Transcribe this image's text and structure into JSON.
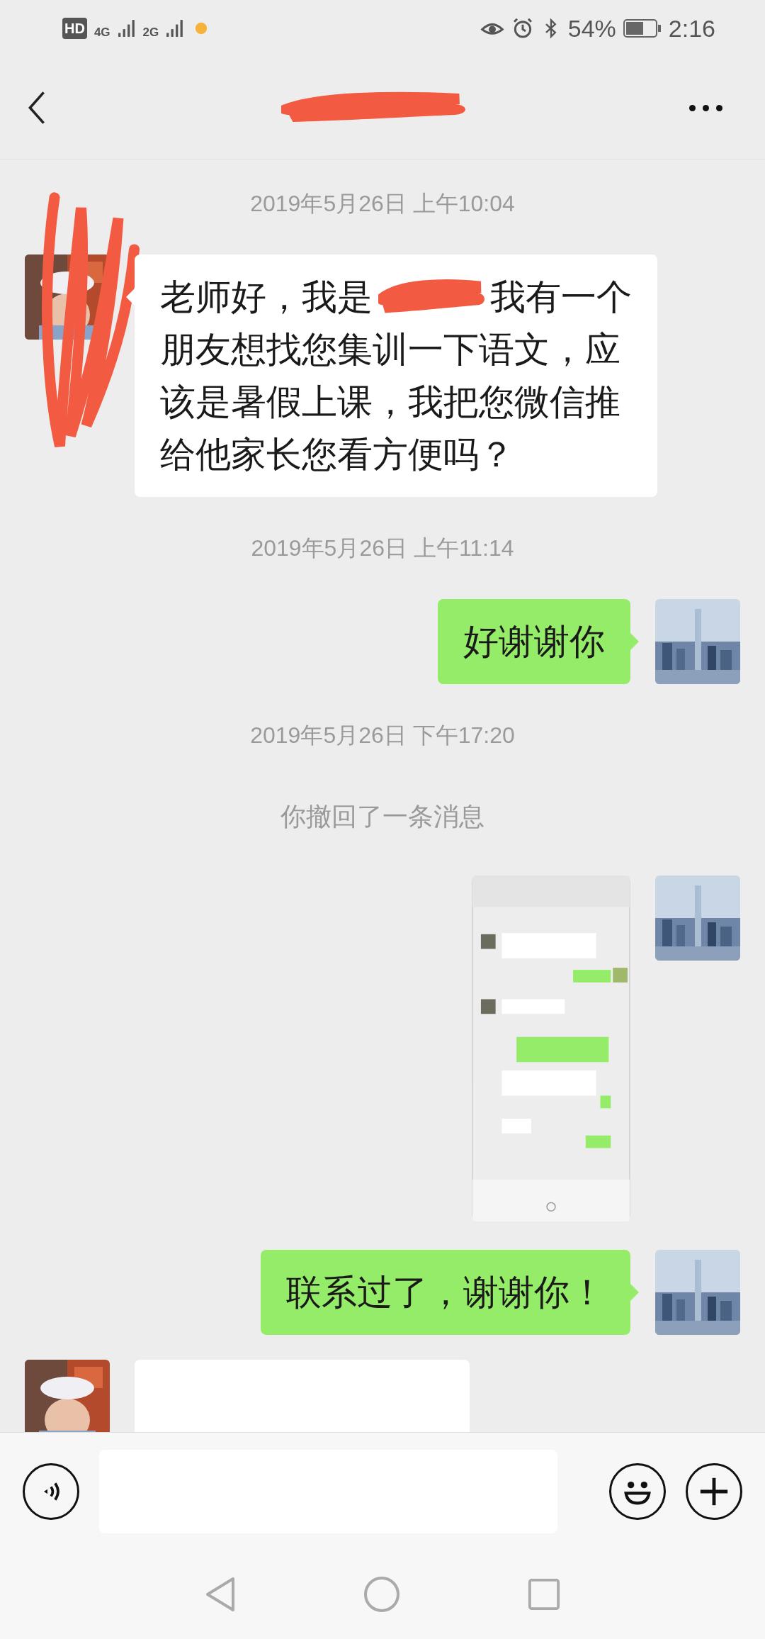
{
  "status_bar": {
    "left": [
      "HD",
      "4G",
      "2G"
    ],
    "battery": "54%",
    "time": "2:16"
  },
  "nav": {
    "title_redacted": true
  },
  "messages": [
    {
      "kind": "time",
      "text": "2019年5月26日 上午10:04"
    },
    {
      "kind": "text_left",
      "redacted_avatar": true,
      "text_before": "老师好，我是",
      "text_after": "我有一个",
      "text_rest": "朋友想找您集训一下语文，应该是暑假上课，我把您微信推给他家长您看方便吗？"
    },
    {
      "kind": "time",
      "text": "2019年5月26日 上午11:14"
    },
    {
      "kind": "text_right",
      "text_before": "好谢谢你"
    },
    {
      "kind": "time",
      "text": "2019年5月26日 下午17:20"
    },
    {
      "kind": "notice",
      "text": "你撤回了一条消息"
    },
    {
      "kind": "image_right"
    },
    {
      "kind": "text_right",
      "text_before": "联系过了，谢谢你！"
    },
    {
      "kind": "partial_left"
    }
  ]
}
